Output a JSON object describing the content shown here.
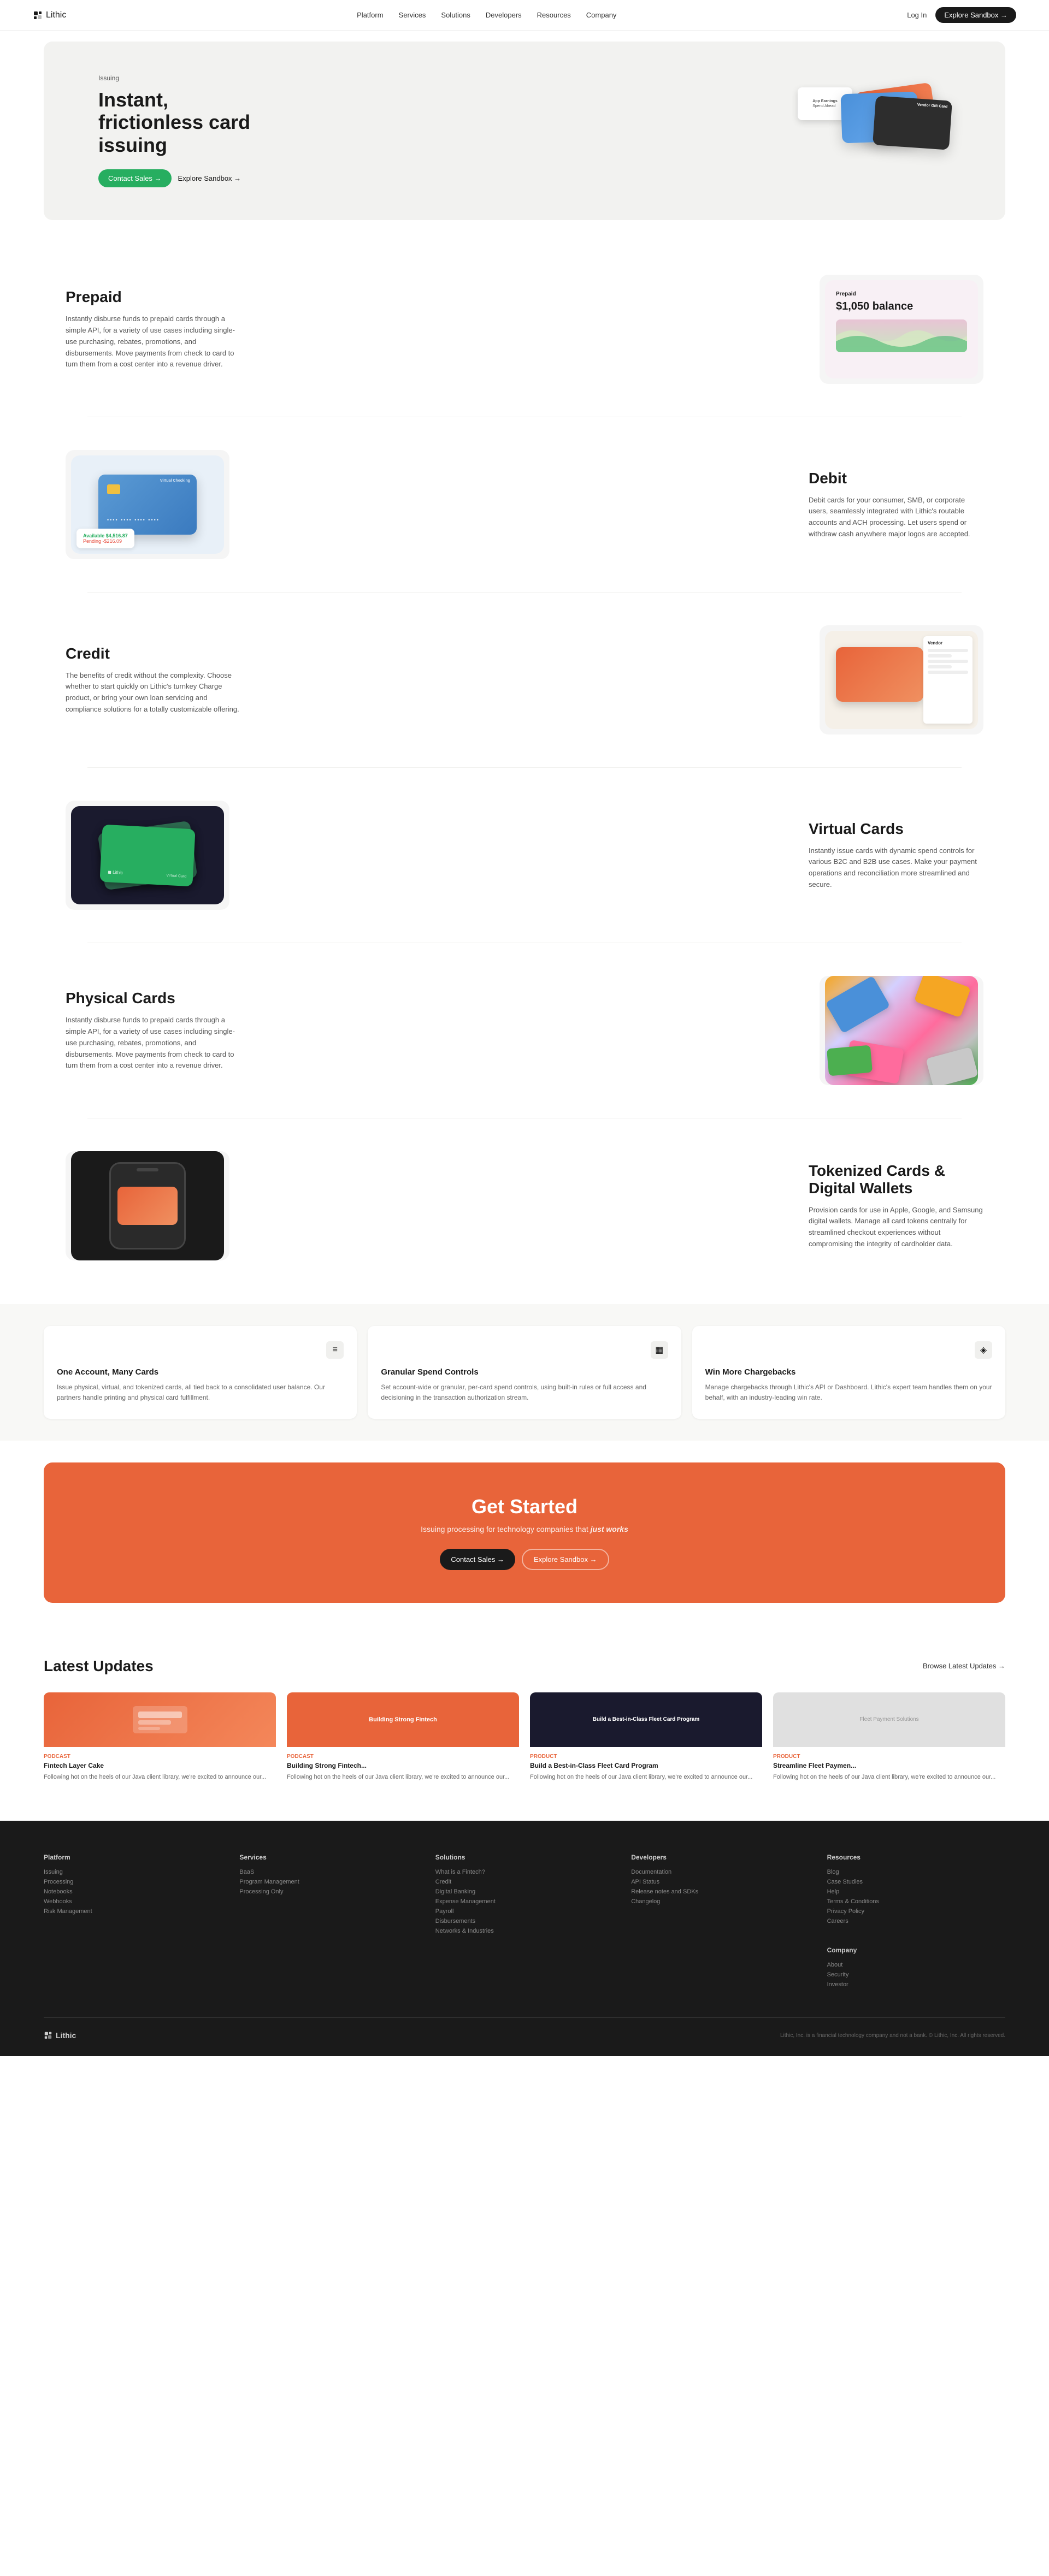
{
  "nav": {
    "logo": "Lithic",
    "logo_icon": "◼",
    "links": [
      "Platform",
      "Services",
      "Solutions",
      "Developers",
      "Resources",
      "Company"
    ],
    "login": "Log In",
    "sandbox_label": "Explore Sandbox →"
  },
  "hero": {
    "eyebrow": "Issuing",
    "title": "Instant, frictionless card issuing",
    "contact_sales": "Contact Sales →",
    "explore_sandbox": "Explore Sandbox →",
    "gift_card_label": "Vendor\nGift Card"
  },
  "features": [
    {
      "id": "prepaid",
      "title": "Prepaid",
      "desc": "Instantly disburse funds to prepaid cards through a simple API, for a variety of use cases including single-use purchasing, rebates, promotions, and disbursements. Move payments from check to card to turn them from a cost center into a revenue driver.",
      "visual_type": "prepaid",
      "card_label": "Prepaid",
      "balance": "$1,050 balance"
    },
    {
      "id": "debit",
      "title": "Debit",
      "desc": "Debit cards for your consumer, SMB, or corporate users, seamlessly integrated with Lithic's routable accounts and ACH processing. Let users spend or withdraw cash anywhere major logos are accepted.",
      "visual_type": "debit",
      "card_label": "Virtual Checking",
      "available": "Available",
      "amount_available": "$4,516.87",
      "pending": "Pending",
      "amount_pending": "-$216.09"
    },
    {
      "id": "credit",
      "title": "Credit",
      "desc": "The benefits of credit without the complexity. Choose whether to start quickly on Lithic's turnkey Charge product, or bring your own loan servicing and compliance solutions for a totally customizable offering.",
      "visual_type": "credit"
    },
    {
      "id": "virtual",
      "title": "Virtual Cards",
      "desc": "Instantly issue cards with dynamic spend controls for various B2C and B2B use cases. Make your payment operations and reconciliation more streamlined and secure.",
      "visual_type": "virtual"
    },
    {
      "id": "physical",
      "title": "Physical Cards",
      "desc": "Instantly disburse funds to prepaid cards through a simple API, for a variety of use cases including single-use purchasing, rebates, promotions, and disbursements. Move payments from check to card to turn them from a cost center into a revenue driver.",
      "visual_type": "physical"
    },
    {
      "id": "tokenized",
      "title": "Tokenized Cards & Digital Wallets",
      "desc": "Provision cards for use in Apple, Google, and Samsung digital wallets. Manage all card tokens centrally for streamlined checkout experiences without compromising the integrity of cardholder data.",
      "visual_type": "tokenized"
    }
  ],
  "benefit_cards": [
    {
      "title": "One Account, Many Cards",
      "desc": "Issue physical, virtual, and tokenized cards, all tied back to a consolidated user balance. Our partners handle printing and physical card fulfillment.",
      "icon": "≡"
    },
    {
      "title": "Granular Spend Controls",
      "desc": "Set account-wide or granular, per-card spend controls, using built-in rules or full access and decisioning in the transaction authorization stream.",
      "icon": "▦"
    },
    {
      "title": "Win More Chargebacks",
      "desc": "Manage chargebacks through Lithic's API or Dashboard. Lithic's expert team handles them on your behalf, with an industry-leading win rate.",
      "icon": "◈"
    }
  ],
  "cta": {
    "title": "Get Started",
    "subtitle_normal": "Issuing processing for technology companies that ",
    "subtitle_em": "just works",
    "contact_sales": "Contact Sales →",
    "explore_sandbox": "Explore Sandbox →"
  },
  "latest_updates": {
    "title": "Latest Updates",
    "browse_label": "Browse Latest Updates →",
    "items": [
      {
        "thumb_type": "orange",
        "label": "Podcast",
        "title": "Fintech Layer Cake",
        "desc": "Following hot on the heels of our Java client library, we're excited to announce our..."
      },
      {
        "thumb_type": "orange-text",
        "label": "Podcast",
        "title": "Building Strong Fintech...",
        "desc": "Following hot on the heels of our Java client library, we're excited to announce our..."
      },
      {
        "thumb_type": "dark",
        "label": "Product",
        "title": "Build a Best-in-Class Fleet Card Program",
        "desc": "Following hot on the heels of our Java client library, we're excited to announce our..."
      },
      {
        "thumb_type": "grey",
        "label": "Product",
        "title": "Streamline Fleet Paymen...",
        "desc": "Following hot on the heels of our Java client library, we're excited to announce our..."
      }
    ]
  },
  "footer": {
    "columns": [
      {
        "title": "Platform",
        "links": [
          "Issuing",
          "Processing",
          "Notebooks",
          "Webhooks",
          "Risk Management"
        ]
      },
      {
        "title": "Services",
        "links": [
          "BaaS",
          "Program Management",
          "Processing Only"
        ]
      },
      {
        "title": "Solutions",
        "links": [
          "What is a Fintech?",
          "Credit",
          "Digital Banking",
          "Expense Management",
          "Payroll",
          "Disbursements",
          "Networks & Industries"
        ]
      },
      {
        "title": "Developers",
        "links": [
          "Documentation",
          "API Status",
          "Release notes and SDKs",
          "Changelog"
        ]
      },
      {
        "title": "Resources",
        "links": [
          "Blog",
          "Case Studies",
          "Help",
          "Terms & Conditions",
          "Privacy Policy",
          "Careers"
        ],
        "company_title": "Company",
        "company_links": [
          "About",
          "Security",
          "Investor"
        ]
      }
    ],
    "logo": "Lithic",
    "legal": "Lithic, Inc. is a financial technology company and not a bank.\n© Lithic, Inc. All rights reserved."
  }
}
